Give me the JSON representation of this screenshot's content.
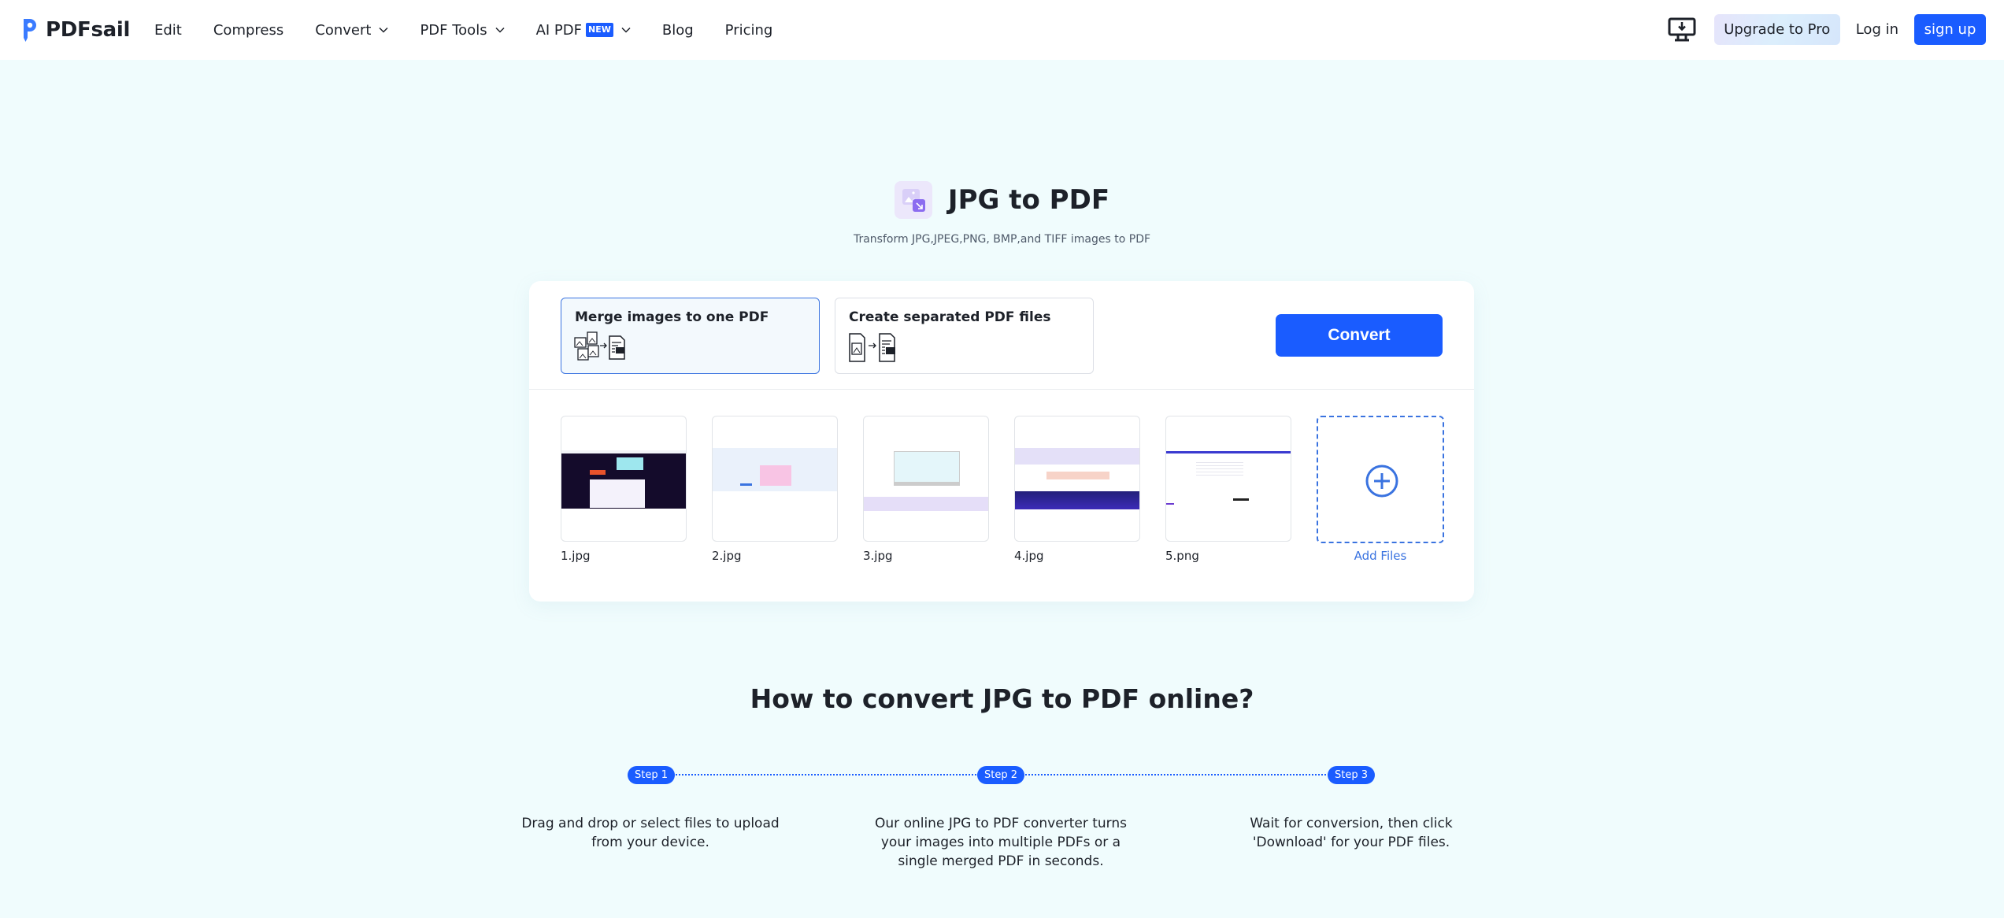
{
  "header": {
    "logo_text": "PDFsail",
    "nav": [
      {
        "label": "Edit",
        "has_dropdown": false
      },
      {
        "label": "Compress",
        "has_dropdown": false
      },
      {
        "label": "Convert",
        "has_dropdown": true
      },
      {
        "label": "PDF Tools",
        "has_dropdown": true
      },
      {
        "label": "AI PDF",
        "has_dropdown": true,
        "badge": "NEW"
      },
      {
        "label": "Blog",
        "has_dropdown": false
      },
      {
        "label": "Pricing",
        "has_dropdown": false
      }
    ],
    "download_icon": "desktop-download-icon",
    "upgrade_label": "Upgrade to Pro",
    "login_label": "Log in",
    "signup_label": "sign up"
  },
  "hero": {
    "icon": "image-convert-icon",
    "title": "JPG to PDF",
    "subtitle": "Transform JPG,JPEG,PNG, BMP,and TIFF images to PDF"
  },
  "converter": {
    "options": [
      {
        "label": "Merge images to one PDF",
        "icon": "merge-images-icon",
        "selected": true
      },
      {
        "label": "Create separated PDF files",
        "icon": "separate-pdf-icon",
        "selected": false
      }
    ],
    "convert_label": "Convert",
    "files": [
      {
        "name": "1.jpg"
      },
      {
        "name": "2.jpg"
      },
      {
        "name": "3.jpg"
      },
      {
        "name": "4.jpg"
      },
      {
        "name": "5.png"
      }
    ],
    "add_files_label": "Add Files"
  },
  "howto": {
    "title": "How to convert JPG to PDF online?",
    "steps": [
      {
        "badge": "Step 1",
        "text": "Drag and drop or select files to upload from your device."
      },
      {
        "badge": "Step 2",
        "text": "Our online JPG to PDF converter turns your images into multiple PDFs or a single merged PDF in seconds."
      },
      {
        "badge": "Step 3",
        "text": "Wait for conversion, then click 'Download' for your PDF files."
      }
    ]
  },
  "colors": {
    "accent": "#1a5cff",
    "page_bg": "#f0fcfd",
    "selected_border": "#3a73e0"
  }
}
